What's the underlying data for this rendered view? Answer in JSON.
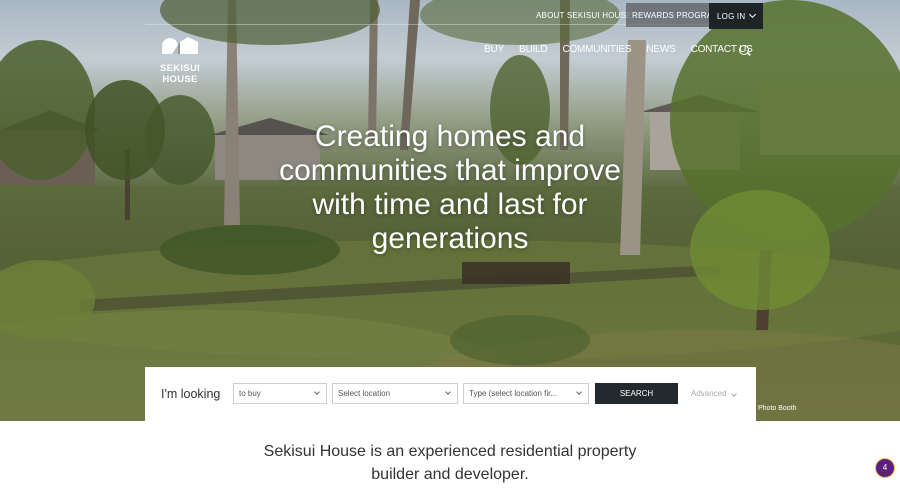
{
  "util_nav": {
    "about": "ABOUT SEKISUI HOUSE",
    "rewards": "REWARDS PROGRAM",
    "login": "LOG IN"
  },
  "logo": {
    "text": "SEKISUI HOUSE"
  },
  "main_nav": [
    "BUY",
    "BUILD",
    "COMMUNITIES",
    "NEWS",
    "CONTACT US"
  ],
  "hero": {
    "headline": "Creating homes and communities that improve with time and last for generations",
    "photo_credit": "Photo Booth"
  },
  "search": {
    "label": "I'm looking",
    "buy_select": "to buy",
    "location_select": "Select location",
    "type_select": "Type (select location fir...",
    "button": "SEARCH",
    "advanced": "Advanced"
  },
  "intro": "Sekisui House is an experienced residential property builder and developer.",
  "badge": {
    "count": "4"
  },
  "colors": {
    "login_bg": "#1e2326",
    "search_btn": "#23292d",
    "badge_bg": "#5b1f7a",
    "badge_border": "#e9c35a"
  }
}
